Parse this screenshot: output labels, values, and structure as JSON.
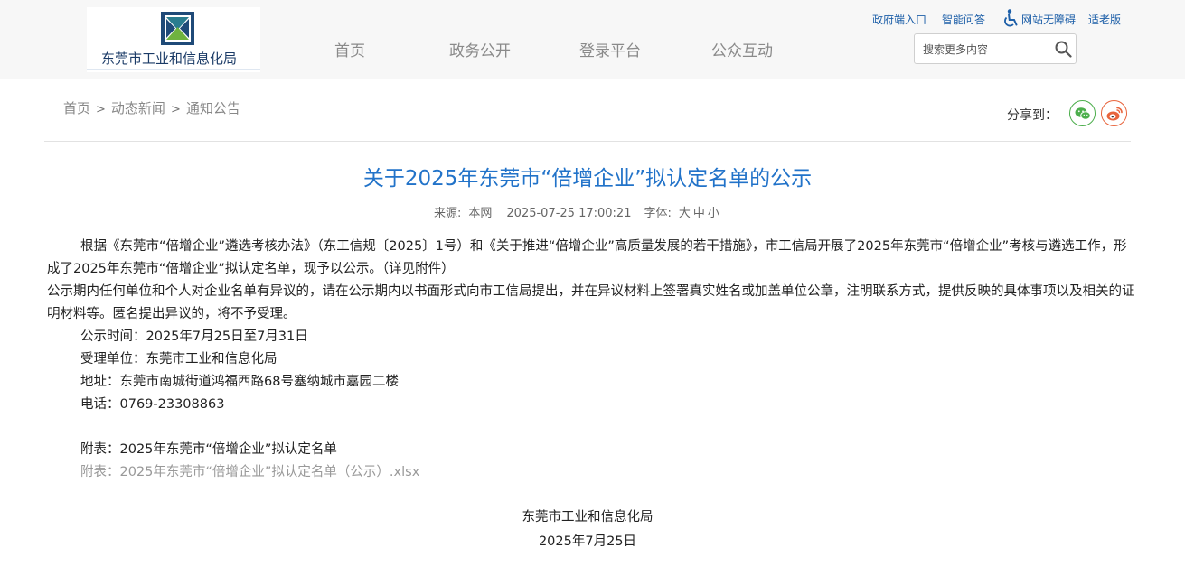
{
  "header": {
    "logo_text": "东莞市工业和信息化局",
    "nav": [
      "首页",
      "政务公开",
      "登录平台",
      "公众互动"
    ],
    "toplinks": {
      "gov_portal": "政府端入口",
      "smart_qa": "智能问答",
      "accessibility": "网站无障碍",
      "elderly": "适老版"
    },
    "search": {
      "placeholder": "搜索更多内容"
    }
  },
  "breadcrumb": [
    "首页",
    "动态新闻",
    "通知公告"
  ],
  "breadcrumb_sep": ">",
  "share": {
    "label": "分享到：",
    "targets": [
      "wechat-icon",
      "weibo-icon"
    ]
  },
  "article": {
    "title": "关于2025年东莞市“倍增企业”拟认定名单的公示",
    "meta": {
      "source_label": "来源:",
      "source": "本网",
      "datetime": "2025-07-25 17:00:21",
      "font_label": "字体:",
      "font_sizes": [
        "大",
        "中",
        "小"
      ]
    },
    "paragraphs": {
      "p1": "根据《东莞市“倍增企业”遴选考核办法》（东工信规〔2025〕1号）和《关于推进“倍增企业”高质量发展的若干措施》，市工信局开展了2025年东莞市“倍增企业”考核与遴选工作，形成了2025年东莞市“倍增企业”拟认定名单，现予以公示。（详见附件）",
      "p2": "公示期内任何单位和个人对企业名单有异议的，请在公示期内以书面形式向市工信局提出，并在异议材料上签署真实姓名或加盖单位公章，注明联系方式，提供反映的具体事项以及相关的证明材料等。匿名提出异议的，将不予受理。",
      "period": "公示时间：2025年7月25日至7月31日",
      "unit": "受理单位：东莞市工业和信息化局",
      "address": "地址：东莞市南城街道鸿福西路68号塞纳城市嘉园二楼",
      "phone": "电话：0769-23308863",
      "attachment_label": "附表：2025年东莞市“倍增企业”拟认定名单",
      "attachment_link": "附表：2025年东莞市“倍增企业”拟认定名单（公示）.xlsx"
    },
    "signoff": {
      "org": "东莞市工业和信息化局",
      "date": "2025年7月25日"
    }
  },
  "colors": {
    "title_blue": "#2273c9",
    "link_blue": "#1d5fa8",
    "logo_navy": "#1a3a66",
    "wechat_green": "#4cae4c",
    "weibo_orange": "#e8643c"
  }
}
